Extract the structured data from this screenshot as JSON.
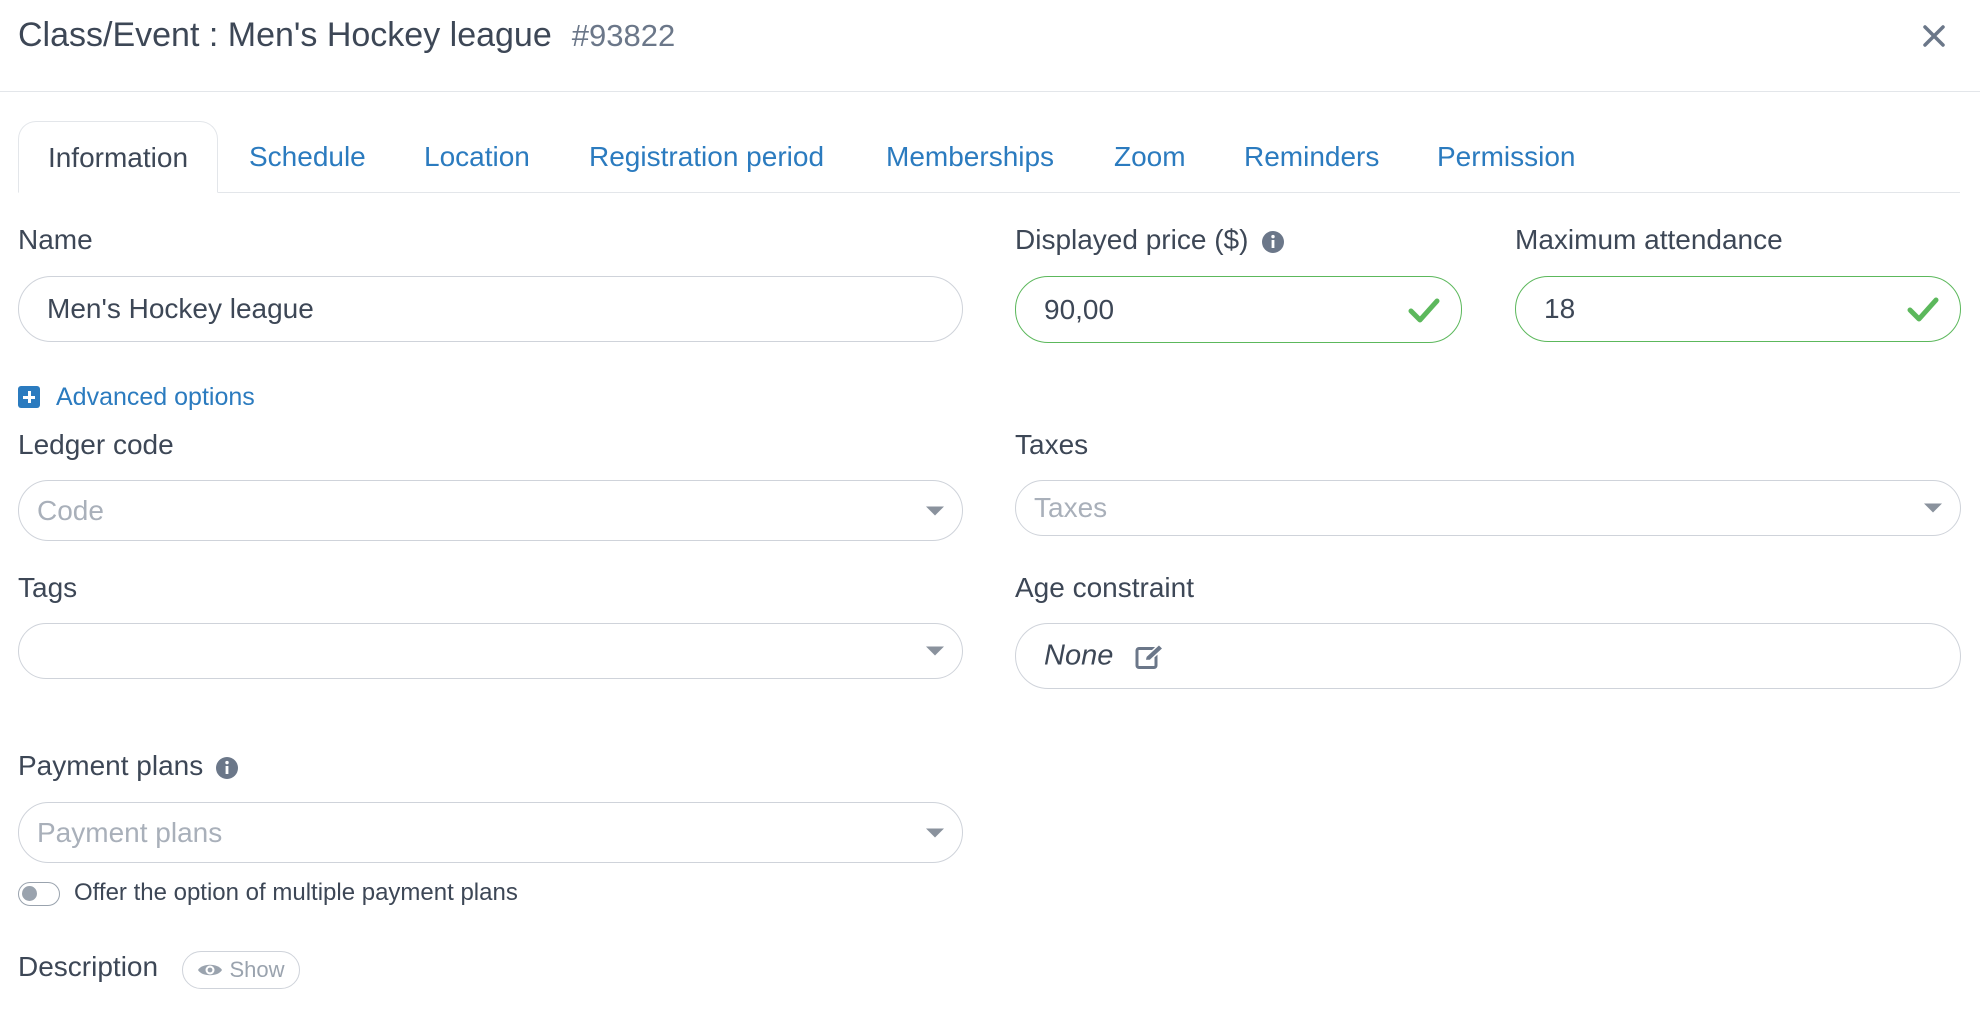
{
  "modal": {
    "title": "Class/Event : Men's Hockey league",
    "id": "#93822",
    "close_icon": "close-icon"
  },
  "tabs": [
    {
      "label": "Information",
      "active": true
    },
    {
      "label": "Schedule"
    },
    {
      "label": "Location"
    },
    {
      "label": "Registration period"
    },
    {
      "label": "Memberships"
    },
    {
      "label": "Zoom"
    },
    {
      "label": "Reminders"
    },
    {
      "label": "Permission"
    }
  ],
  "form": {
    "name": {
      "label": "Name",
      "value": "Men's Hockey league"
    },
    "price": {
      "label": "Displayed price ($)",
      "value": "90,00"
    },
    "max_attendance": {
      "label": "Maximum attendance",
      "value": "18"
    },
    "advanced_options": "Advanced options",
    "ledger_code": {
      "label": "Ledger code",
      "placeholder": "Code"
    },
    "taxes": {
      "label": "Taxes",
      "placeholder": "Taxes"
    },
    "tags": {
      "label": "Tags",
      "value": ""
    },
    "age_constraint": {
      "label": "Age constraint",
      "value": "None"
    },
    "payment_plans": {
      "label": "Payment plans",
      "placeholder": "Payment plans"
    },
    "multiple_plans_toggle": {
      "label": "Offer the option of multiple payment plans",
      "checked": false
    },
    "description": {
      "label": "Description",
      "show_label": "Show"
    }
  },
  "colors": {
    "link": "#2b7bbf",
    "valid": "#5cb85c",
    "text": "#3d4756",
    "placeholder": "#a9b0ba"
  }
}
